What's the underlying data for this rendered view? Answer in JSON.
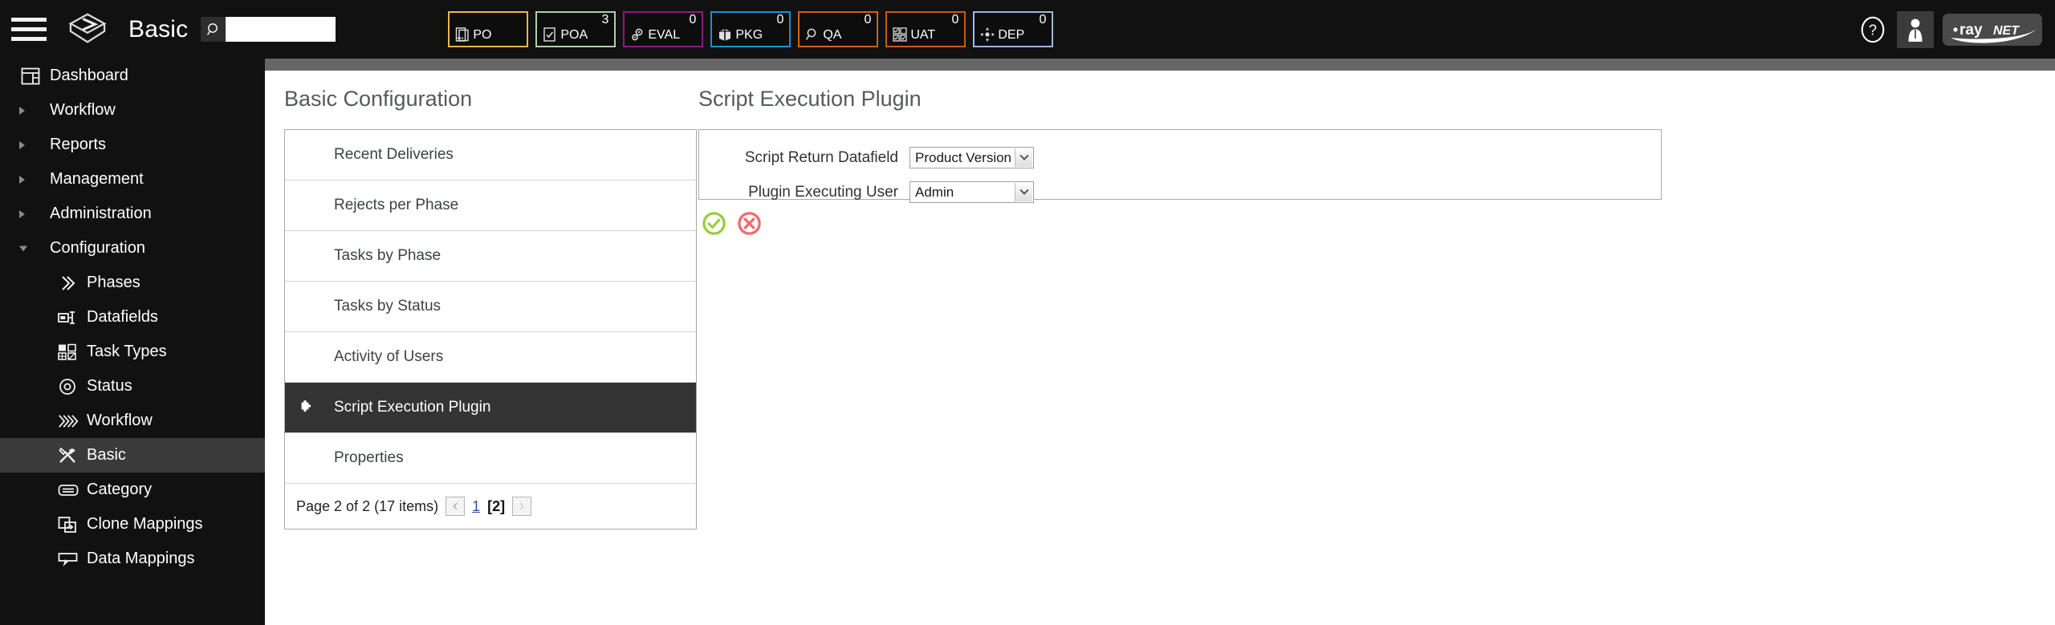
{
  "header": {
    "app_title": "Basic",
    "search_value": "",
    "search_placeholder": "",
    "search_icon": "magnifier-icon",
    "menu_icon": "hamburger-menu-icon",
    "logo_icon": "raynet-box-logo-icon",
    "help_icon": "help-question-icon",
    "user_icon": "user-account-icon",
    "brand_text_dot": "•",
    "brand_text_ray": "ray",
    "brand_text_net": "NET"
  },
  "badges": [
    {
      "label": "PO",
      "count": "",
      "color": "#f0b54a",
      "icon": "document-po-icon"
    },
    {
      "label": "POA",
      "count": "3",
      "color": "#a9d4a1",
      "icon": "document-check-icon"
    },
    {
      "label": "EVAL",
      "count": "0",
      "color": "#8e1a7a",
      "icon": "gears-icon"
    },
    {
      "label": "PKG",
      "count": "0",
      "color": "#1a8fd8",
      "icon": "package-box-icon"
    },
    {
      "label": "QA",
      "count": "0",
      "color": "#d2601a",
      "icon": "magnifier-qa-icon"
    },
    {
      "label": "UAT",
      "count": "0",
      "color": "#c85a14",
      "icon": "checklist-grid-icon"
    },
    {
      "label": "DEP",
      "count": "0",
      "color": "#9fb6e0",
      "icon": "deploy-arrows-icon"
    }
  ],
  "sidebar": {
    "items": [
      {
        "label": "Dashboard",
        "level": 0,
        "icon": "dashboard-icon",
        "caret": "none",
        "selected": false
      },
      {
        "label": "Workflow",
        "level": 0,
        "icon": "none",
        "caret": "closed",
        "selected": false
      },
      {
        "label": "Reports",
        "level": 0,
        "icon": "none",
        "caret": "closed",
        "selected": false
      },
      {
        "label": "Management",
        "level": 0,
        "icon": "none",
        "caret": "closed",
        "selected": false
      },
      {
        "label": "Administration",
        "level": 0,
        "icon": "none",
        "caret": "closed",
        "selected": false
      },
      {
        "label": "Configuration",
        "level": 0,
        "icon": "none",
        "caret": "open",
        "selected": false
      },
      {
        "label": "Phases",
        "level": 1,
        "icon": "chevrons-icon",
        "caret": "none",
        "selected": false
      },
      {
        "label": "Datafields",
        "level": 1,
        "icon": "datafields-icon",
        "caret": "none",
        "selected": false
      },
      {
        "label": "Task Types",
        "level": 1,
        "icon": "task-types-icon",
        "caret": "none",
        "selected": false
      },
      {
        "label": "Status",
        "level": 1,
        "icon": "status-circle-icon",
        "caret": "none",
        "selected": false
      },
      {
        "label": "Workflow",
        "level": 1,
        "icon": "workflow-chevrons-icon",
        "caret": "none",
        "selected": false
      },
      {
        "label": "Basic",
        "level": 1,
        "icon": "tools-icon",
        "caret": "none",
        "selected": true
      },
      {
        "label": "Category",
        "level": 1,
        "icon": "category-icon",
        "caret": "none",
        "selected": false
      },
      {
        "label": "Clone Mappings",
        "level": 1,
        "icon": "clone-mappings-icon",
        "caret": "none",
        "selected": false
      },
      {
        "label": "Data Mappings",
        "level": 1,
        "icon": "data-mappings-icon",
        "caret": "none",
        "selected": false
      }
    ]
  },
  "left_panel": {
    "title": "Basic Configuration",
    "rows": [
      {
        "label": "Recent Deliveries",
        "icon": "none",
        "selected": false
      },
      {
        "label": "Rejects per Phase",
        "icon": "none",
        "selected": false
      },
      {
        "label": "Tasks by Phase",
        "icon": "none",
        "selected": false
      },
      {
        "label": "Tasks by Status",
        "icon": "none",
        "selected": false
      },
      {
        "label": "Activity of Users",
        "icon": "none",
        "selected": false
      },
      {
        "label": "Script Execution Plugin",
        "icon": "puzzle-piece-icon",
        "selected": true
      },
      {
        "label": "Properties",
        "icon": "none",
        "selected": false
      }
    ],
    "pager": {
      "text": "Page 2 of 2 (17 items)",
      "prev_icon": "chevron-left-icon",
      "next_icon": "chevron-right-icon",
      "page_1": "1",
      "page_current": "[2]"
    }
  },
  "right_panel": {
    "title": "Script Execution Plugin",
    "fields": [
      {
        "label": "Script Return Datafield",
        "value": "Product Version"
      },
      {
        "label": "Plugin Executing User",
        "value": "Admin"
      }
    ],
    "accept_icon": "accept-check-icon",
    "cancel_icon": "cancel-x-icon",
    "accept_color": "#9ACD3C",
    "cancel_color": "#F4696E"
  }
}
